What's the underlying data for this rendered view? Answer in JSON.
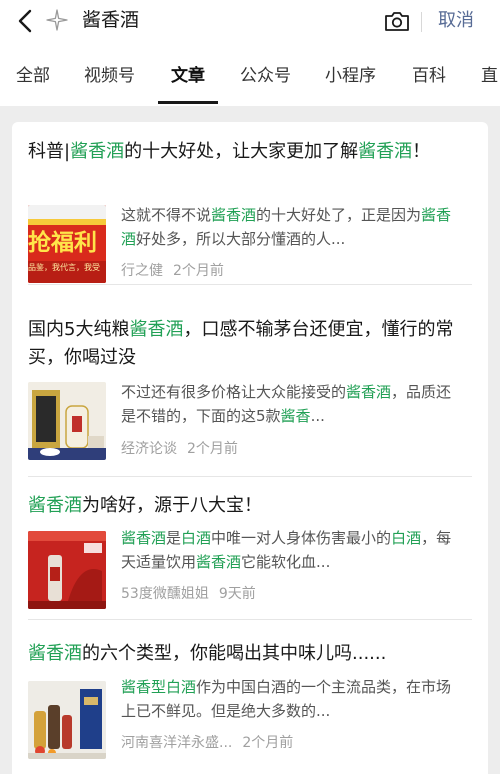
{
  "search": {
    "query": "酱香酒",
    "cancel_label": "取消"
  },
  "tabs": [
    {
      "label": "全部",
      "active": false
    },
    {
      "label": "视频号",
      "active": false
    },
    {
      "label": "文章",
      "active": true
    },
    {
      "label": "公众号",
      "active": false
    },
    {
      "label": "小程序",
      "active": false
    },
    {
      "label": "百科",
      "active": false
    },
    {
      "label": "直",
      "active": false
    }
  ],
  "colors": {
    "highlight": "#21a055",
    "link_blue": "#576b95",
    "meta_gray": "#a0a0a0",
    "background": "#ededed"
  },
  "articles": [
    {
      "title": [
        {
          "t": "科普|",
          "hl": false
        },
        {
          "t": "酱香酒",
          "hl": true
        },
        {
          "t": "的十大好处，让大家更加了解",
          "hl": false
        },
        {
          "t": "酱香酒",
          "hl": true
        },
        {
          "t": "！",
          "hl": false
        }
      ],
      "snippet": [
        {
          "t": "这就不得不说",
          "hl": false
        },
        {
          "t": "酱香酒",
          "hl": true
        },
        {
          "t": "的十大好处了，正是因为",
          "hl": false
        },
        {
          "t": "酱香酒",
          "hl": true
        },
        {
          "t": "好处多，所以大部分懂酒的人...",
          "hl": false
        }
      ],
      "thumb_text": "抢福利",
      "thumb_sub": "品鉴，我代言，我受",
      "source": "行之健",
      "time": "2个月前"
    },
    {
      "title": [
        {
          "t": "国内5大纯粮",
          "hl": false
        },
        {
          "t": "酱香酒",
          "hl": true
        },
        {
          "t": "，口感不输茅台还便宜，懂行的常买，你喝过没",
          "hl": false
        }
      ],
      "snippet": [
        {
          "t": "不过还有很多价格让大众能接受的",
          "hl": false
        },
        {
          "t": "酱香酒",
          "hl": true
        },
        {
          "t": "，品质还是不错的，下面的这5款",
          "hl": false
        },
        {
          "t": "酱香",
          "hl": true
        },
        {
          "t": "...",
          "hl": false
        }
      ],
      "source": "经济论谈",
      "time": "2个月前"
    },
    {
      "title": [
        {
          "t": "酱香酒",
          "hl": true
        },
        {
          "t": "为啥好，源于八大宝！",
          "hl": false
        }
      ],
      "snippet": [
        {
          "t": "酱香酒",
          "hl": true
        },
        {
          "t": "是",
          "hl": false
        },
        {
          "t": "白酒",
          "hl": true
        },
        {
          "t": "中唯一对人身体伤害最小的",
          "hl": false
        },
        {
          "t": "白酒",
          "hl": true
        },
        {
          "t": "，每天适量饮用",
          "hl": false
        },
        {
          "t": "酱香酒",
          "hl": true
        },
        {
          "t": "它能软化血...",
          "hl": false
        }
      ],
      "source": "53度微醺姐姐",
      "time": "9天前"
    },
    {
      "title": [
        {
          "t": "酱香酒",
          "hl": true
        },
        {
          "t": "的六个类型，你能喝出其中味儿吗......",
          "hl": false
        }
      ],
      "snippet": [
        {
          "t": "酱香型白酒",
          "hl": true
        },
        {
          "t": "作为中国白酒的一个主流品类，在市场上已不鲜见。但是绝大多数的...",
          "hl": false
        }
      ],
      "source": "河南喜洋洋永盛...",
      "time": "2个月前"
    }
  ]
}
